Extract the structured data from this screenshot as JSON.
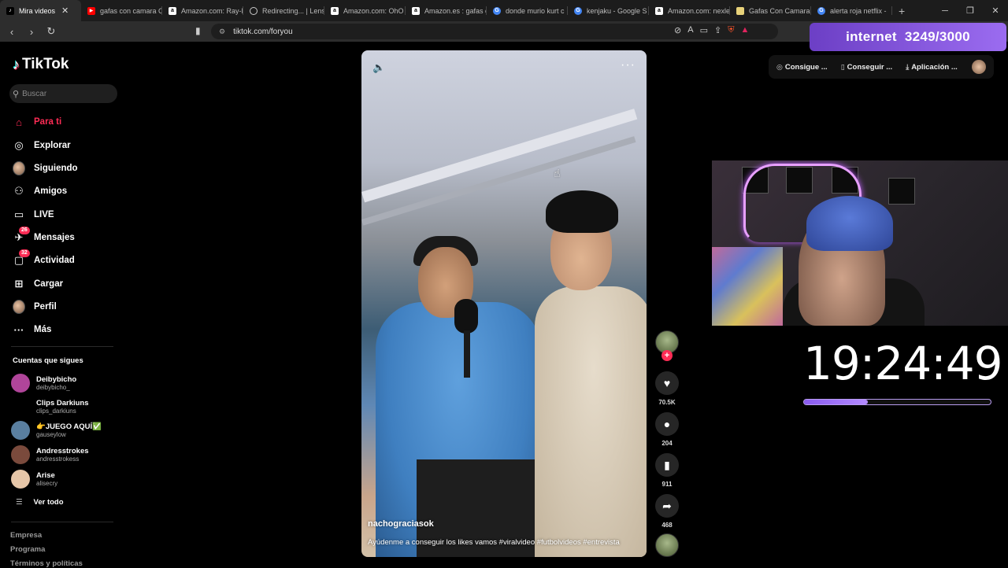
{
  "browser": {
    "tabs": [
      {
        "label": "Mira videos",
        "icon": "tiktok-icon",
        "color": "#000000",
        "active": true
      },
      {
        "label": "gafas con camara C",
        "icon": "youtube-icon",
        "color": "#ff0000"
      },
      {
        "label": "Amazon.com: Ray-B",
        "icon": "amazon-icon",
        "color": "#ffffff"
      },
      {
        "label": "Redirecting... | Lens",
        "icon": "loading-icon",
        "color": "#cccccc"
      },
      {
        "label": "Amazon.com: OhO",
        "icon": "amazon-icon",
        "color": "#ffffff"
      },
      {
        "label": "Amazon.es : gafas c",
        "icon": "amazon-icon",
        "color": "#ffffff"
      },
      {
        "label": "donde murio kurt c",
        "icon": "google-icon",
        "color": "#4285f4"
      },
      {
        "label": "kenjaku - Google S",
        "icon": "google-icon",
        "color": "#4285f4"
      },
      {
        "label": "Amazon.com: nexle",
        "icon": "amazon-icon",
        "color": "#ffffff"
      },
      {
        "label": "Gafas Con Camara |",
        "icon": "glasses-icon",
        "color": "#e8d27a"
      },
      {
        "label": "alerta roja netflix -",
        "icon": "google-icon",
        "color": "#4285f4"
      }
    ],
    "close_glyph": "✕",
    "newtab_glyph": "+",
    "url": "tiktok.com/foryou"
  },
  "overlay": {
    "internet_label": "internet",
    "internet_count": "3249/3000",
    "clock": "19:24:49",
    "progress_fraction": 0.34
  },
  "sidebar": {
    "logo_text": "TikTok",
    "search_placeholder": "Buscar",
    "nav": [
      {
        "label": "Para ti",
        "icon": "home-icon",
        "glyph": "⌂",
        "active": true
      },
      {
        "label": "Explorar",
        "icon": "compass-icon",
        "glyph": "◎"
      },
      {
        "label": "Siguiendo",
        "icon": "following-avatar-icon",
        "glyph": ""
      },
      {
        "label": "Amigos",
        "icon": "friends-icon",
        "glyph": "⚇"
      },
      {
        "label": "LIVE",
        "icon": "live-icon",
        "glyph": "▭"
      },
      {
        "label": "Mensajes",
        "icon": "messages-icon",
        "glyph": "✈",
        "badge": "26"
      },
      {
        "label": "Actividad",
        "icon": "activity-icon",
        "glyph": "▢",
        "badge": "32"
      },
      {
        "label": "Cargar",
        "icon": "upload-icon",
        "glyph": "⊞"
      },
      {
        "label": "Perfil",
        "icon": "profile-avatar-icon",
        "glyph": ""
      },
      {
        "label": "Más",
        "icon": "more-icon",
        "glyph": "···"
      }
    ],
    "following_title": "Cuentas que sigues",
    "following": [
      {
        "display": "Deibybicho",
        "user": "deibybicho_",
        "avatar_color": "#b0459a"
      },
      {
        "display": "Clips Darkiuns",
        "user": "clips_darkiuns",
        "avatar_color": "#000000"
      },
      {
        "display": "👉JUEGO AQUÍ✅",
        "user": "gauseylow",
        "avatar_color": "#5a7fa0"
      },
      {
        "display": "Andresstrokes",
        "user": "andresstrokess",
        "avatar_color": "#7a4a3c"
      },
      {
        "display": "Arise",
        "user": "alisecry",
        "avatar_color": "#e6c6a8"
      }
    ],
    "see_all": "Ver todo",
    "footer": [
      "Empresa",
      "Programa",
      "Términos y políticas"
    ]
  },
  "video": {
    "author": "nachograciasok",
    "caption": "Ayúdenme a conseguir los likes vamos #viralvideo #futbolvideos #entrevista",
    "likes": "70.5K",
    "comments": "204",
    "saves": "911",
    "shares": "468"
  },
  "header": {
    "buttons": [
      {
        "label": "Consigue ...",
        "icon": "coin-icon",
        "glyph": "◎"
      },
      {
        "label": "Conseguir ...",
        "icon": "phone-icon",
        "glyph": "▯"
      },
      {
        "label": "Aplicación ...",
        "icon": "download-icon",
        "glyph": "⤓"
      }
    ]
  }
}
